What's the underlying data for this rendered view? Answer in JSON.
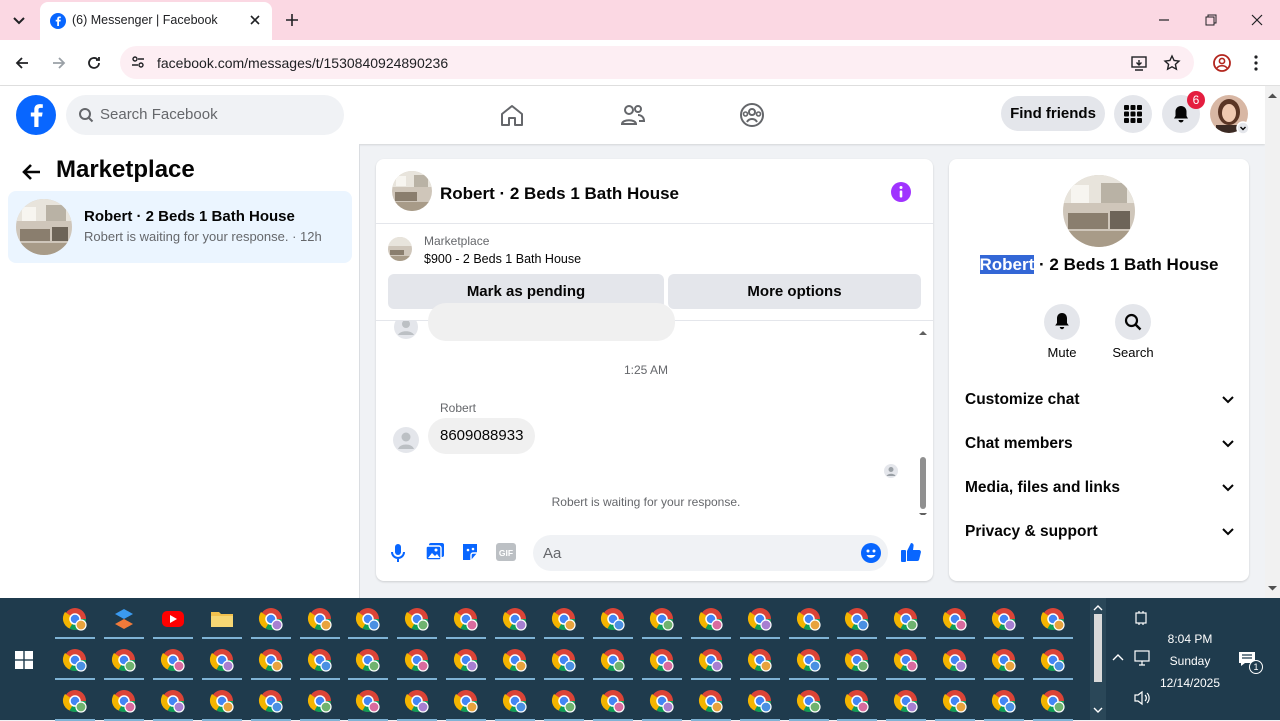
{
  "browser": {
    "tab_title": "(6) Messenger | Facebook",
    "url": "facebook.com/messages/t/1530840924890236"
  },
  "header": {
    "search_placeholder": "Search Facebook",
    "find_friends": "Find friends",
    "notification_count": "6"
  },
  "left": {
    "title": "Marketplace",
    "item": {
      "name": "Robert · 2 Beds 1 Bath House",
      "preview": "Robert is waiting for your response. · 12h"
    }
  },
  "chat": {
    "title": "Robert · 2 Beds 1 Bath House",
    "marketplace_label": "Marketplace",
    "listing": "$900 - 2 Beds 1 Bath House",
    "mark_pending": "Mark as pending",
    "more_options": "More options",
    "timestamp": "1:25 AM",
    "sender": "Robert",
    "message": "8609088933",
    "status": "Robert is waiting for your response.",
    "composer_placeholder": "Aa"
  },
  "info": {
    "name_highlight": "Robert",
    "name_rest": " · 2 Beds 1 Bath House",
    "mute": "Mute",
    "search": "Search",
    "rows": [
      "Customize chat",
      "Chat members",
      "Media, files and links",
      "Privacy & support"
    ]
  },
  "taskbar": {
    "time": "8:04 PM",
    "day": "Sunday",
    "date": "12/14/2025",
    "notif_count": "1"
  },
  "colors": {
    "fb_blue": "#0866ff",
    "purple": "#a033ff",
    "tab_bg": "#fbd8e3",
    "taskbar": "#1f3b4d"
  }
}
